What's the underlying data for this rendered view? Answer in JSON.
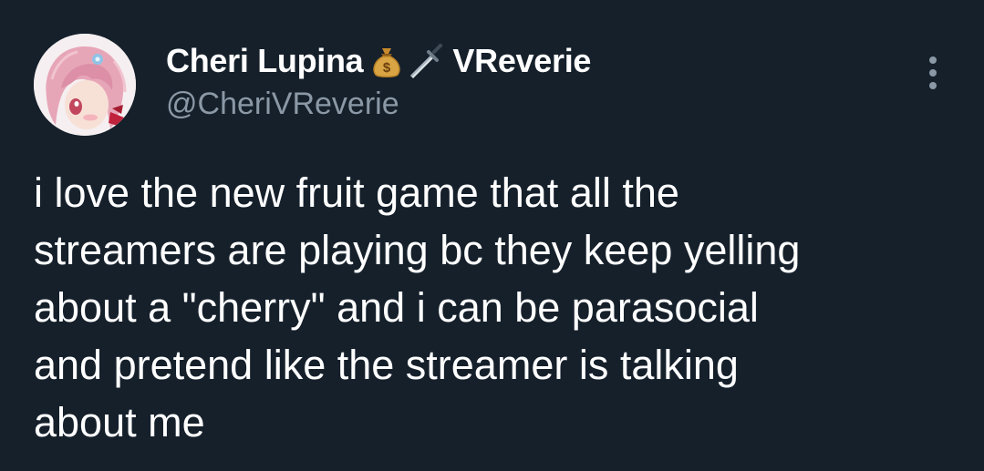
{
  "tweet": {
    "author": {
      "display_name": "Cheri Lupina",
      "name_emojis": [
        "money-bag-icon",
        "dagger-icon"
      ],
      "display_name_suffix": "VReverie",
      "handle": "@CheriVReverie",
      "avatar": "anime-avatar"
    },
    "text_lines": [
      "i love the new fruit game that all the",
      "streamers are playing bc they keep yelling",
      "about a \"cherry\" and i can be parasocial",
      "and pretend like the streamer is talking",
      "about me"
    ]
  },
  "colors": {
    "background": "#15202b",
    "primary_text": "#ffffff",
    "secondary_text": "#8b98a5"
  },
  "icons": {
    "more": "more-options-icon"
  }
}
